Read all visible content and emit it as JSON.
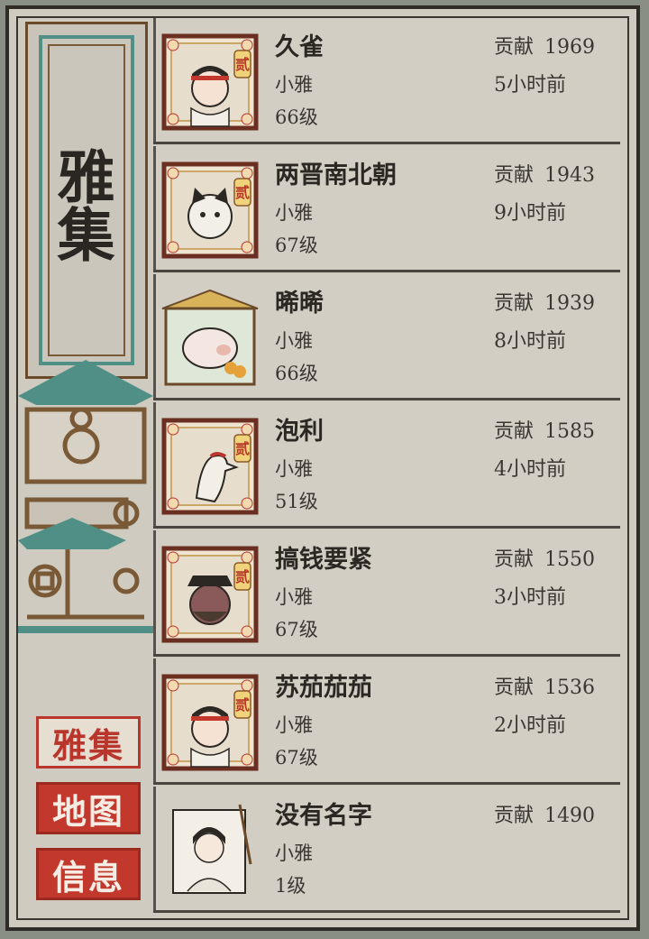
{
  "sidebar": {
    "title": "雅集",
    "nav": [
      {
        "label": "雅集",
        "active": true
      },
      {
        "label": "地图",
        "active": false
      },
      {
        "label": "信息",
        "active": false
      }
    ]
  },
  "members": [
    {
      "name": "久雀",
      "role": "小雅",
      "level": "66级",
      "contrib_label": "贡献",
      "contrib": "1969",
      "time": "5小时前",
      "avatar": "boy-headband-portrait",
      "badge": "贰"
    },
    {
      "name": "两晋南北朝",
      "role": "小雅",
      "level": "67级",
      "contrib_label": "贡献",
      "contrib": "1943",
      "time": "9小时前",
      "avatar": "cat-portrait",
      "badge": "贰"
    },
    {
      "name": "晞晞",
      "role": "小雅",
      "level": "66级",
      "contrib_label": "贡献",
      "contrib": "1939",
      "time": "8小时前",
      "avatar": "pig-portrait",
      "badge": ""
    },
    {
      "name": "泡利",
      "role": "小雅",
      "level": "51级",
      "contrib_label": "贡献",
      "contrib": "1585",
      "time": "4小时前",
      "avatar": "eagle-portrait",
      "badge": "贰"
    },
    {
      "name": "搞钱要紧",
      "role": "小雅",
      "level": "67级",
      "contrib_label": "贡献",
      "contrib": "1550",
      "time": "3小时前",
      "avatar": "official-portrait",
      "badge": "贰"
    },
    {
      "name": "苏茄茄茄",
      "role": "小雅",
      "level": "67级",
      "contrib_label": "贡献",
      "contrib": "1536",
      "time": "2小时前",
      "avatar": "boy-headband-portrait",
      "badge": "贰"
    },
    {
      "name": "没有名字",
      "role": "小雅",
      "level": "1级",
      "contrib_label": "贡献",
      "contrib": "1490",
      "time": "",
      "avatar": "scroll-scholar-portrait",
      "badge": ""
    }
  ],
  "colors": {
    "accent_red": "#c2382d",
    "teal": "#4f8f86",
    "ink": "#2b2723",
    "paper": "#d2cec4"
  }
}
